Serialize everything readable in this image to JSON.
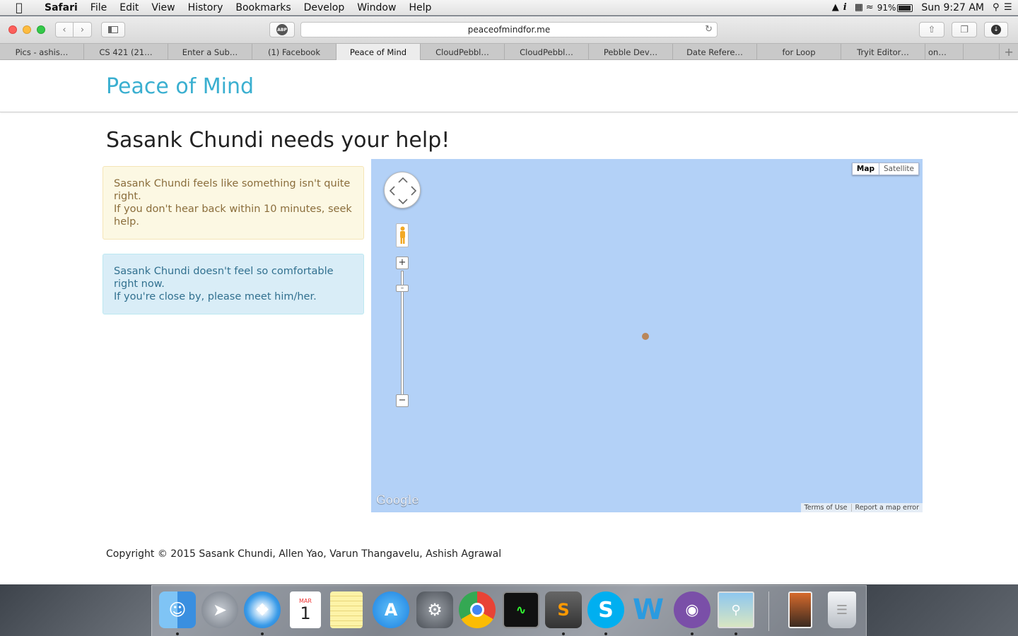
{
  "menubar": {
    "app": "Safari",
    "items": [
      "File",
      "Edit",
      "View",
      "History",
      "Bookmarks",
      "Develop",
      "Window",
      "Help"
    ],
    "battery": "91%",
    "clock": "Sun 9:27 AM"
  },
  "browser": {
    "url": "peaceofmindfor.me",
    "tabs": [
      "Pics - ashis…",
      "CS 421 (21…",
      "Enter a Sub…",
      "(1) Facebook",
      "Peace of Mind",
      "CloudPebbl…",
      "CloudPebbl…",
      "Pebble Dev…",
      "Date Refere…",
      "for Loop",
      "Tryit Editor…",
      "on…"
    ],
    "active_tab": 4
  },
  "site": {
    "brand": "Peace of Mind",
    "heading": "Sasank Chundi needs your help!",
    "warning": {
      "line1": "Sasank Chundi feels like something isn't quite right.",
      "line2": "If you don't hear back within 10 minutes, seek help."
    },
    "info": {
      "line1": "Sasank Chundi doesn't feel so comfortable right now.",
      "line2": "If you're close by, please meet him/her."
    },
    "map": {
      "type_map": "Map",
      "type_satellite": "Satellite",
      "logo": "Google",
      "terms": "Terms of Use",
      "report": "Report a map error"
    },
    "copyright": "Copyright © 2015 Sasank Chundi, Allen Yao, Varun Thangavelu, Ashish Agrawal"
  },
  "dock": {
    "calendar_month": "MAR",
    "calendar_day": "1",
    "apps": [
      "finder-icon",
      "launchpad-icon",
      "safari-icon",
      "calendar-icon",
      "notes-icon",
      "app-store-icon",
      "system-preferences-icon",
      "chrome-icon",
      "activity-monitor-icon",
      "sublime-text-icon",
      "skype-icon",
      "word-icon",
      "github-icon",
      "preview-icon",
      "downloads-stack-icon",
      "trash-icon"
    ]
  },
  "colors": {
    "brand": "#3aafd0",
    "map_water": "#b3d1f7",
    "warning_bg": "#fcf8e3",
    "info_bg": "#d9edf7"
  }
}
